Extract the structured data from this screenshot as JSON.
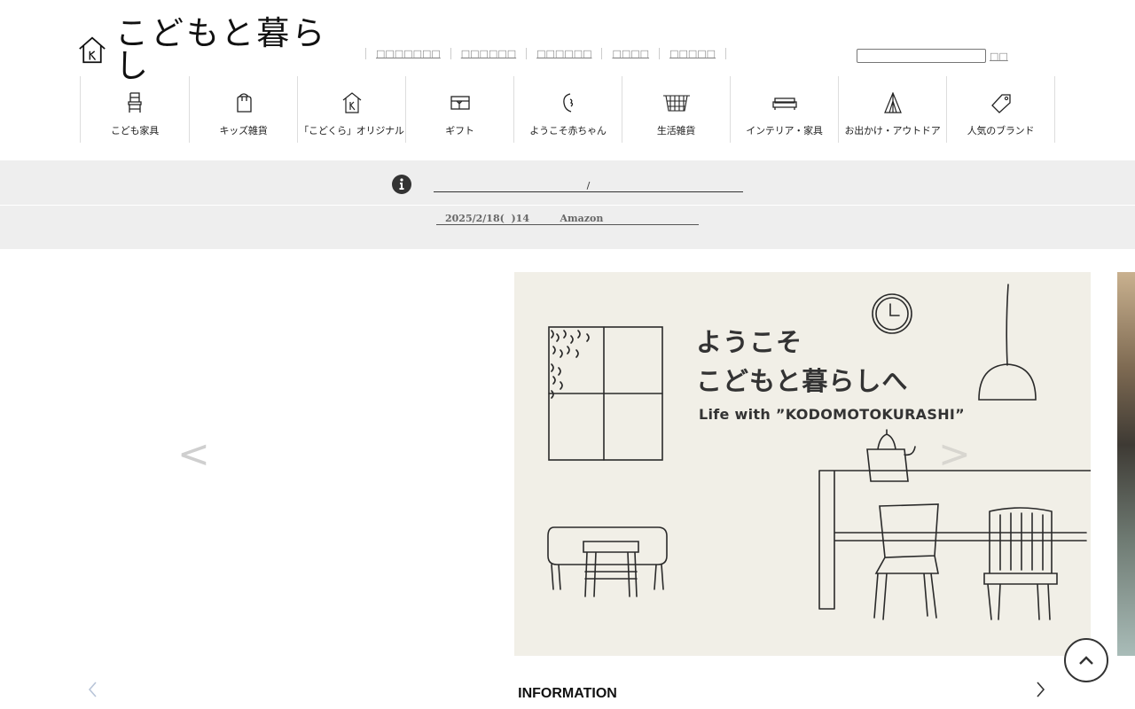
{
  "site": {
    "logo_text": "こどもと暮らし"
  },
  "header": {
    "links": [
      "□□□□□□□",
      "□□□□□□",
      "□□□□□□",
      "□□□□",
      "□□□□□"
    ],
    "search": {
      "value": "",
      "button_label": "□□"
    }
  },
  "categories": [
    {
      "label": "こども家具",
      "icon": "chair-icon"
    },
    {
      "label": "キッズ雑貨",
      "icon": "backpack-icon"
    },
    {
      "label": "「こどくら」オリジナル",
      "icon": "house-logo-icon"
    },
    {
      "label": "ギフト",
      "icon": "gift-icon"
    },
    {
      "label": "ようこそ赤ちゃん",
      "icon": "baby-icon"
    },
    {
      "label": "生活雑貨",
      "icon": "basket-icon"
    },
    {
      "label": "インテリア・家具",
      "icon": "sofa-icon"
    },
    {
      "label": "お出かけ・アウトドア",
      "icon": "tent-icon"
    },
    {
      "label": "人気のブランド",
      "icon": "tag-icon"
    }
  ],
  "notice": {
    "line1": "/",
    "line2": "2025/2/18(  )14         Amazon"
  },
  "hero": {
    "heading_line1": "ようこそ",
    "heading_line2": "こどもと暮らしへ",
    "subtitle": "Life with ”KODOMOTOKURASHI”",
    "prev_arrow": "<",
    "next_arrow": ">"
  },
  "information": {
    "title": "INFORMATION"
  },
  "colors": {
    "notice_bg": "#eeeeee",
    "hero_bg": "#f1efe7",
    "text": "#222222"
  }
}
